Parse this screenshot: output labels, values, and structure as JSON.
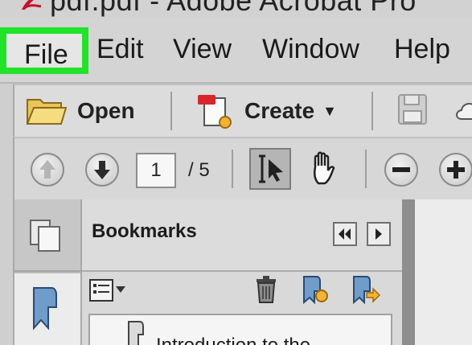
{
  "window": {
    "title": "pdf.pdf - Adobe Acrobat Pro"
  },
  "menu": {
    "items": [
      {
        "label": "File",
        "highlighted": true
      },
      {
        "label": "Edit"
      },
      {
        "label": "View"
      },
      {
        "label": "Window"
      },
      {
        "label": "Help"
      }
    ],
    "highlight_color": "#22e22a"
  },
  "toolbar": {
    "open_label": "Open",
    "create_label": "Create",
    "icons": [
      "folder-icon",
      "create-pdf-icon",
      "save-icon",
      "cloud-icon"
    ]
  },
  "navigation": {
    "current_page": "1",
    "total_pages": "/ 5",
    "icons": [
      "previous-page-icon",
      "next-page-icon",
      "select-tool-icon",
      "hand-tool-icon",
      "zoom-out-icon",
      "zoom-in-icon"
    ]
  },
  "bookmarks_panel": {
    "title": "Bookmarks",
    "items": [
      "Introduction to the"
    ],
    "icons": [
      "options-menu-icon",
      "delete-bookmark-icon",
      "new-bookmark-icon",
      "bookmark-from-structure-icon"
    ]
  },
  "colors": {
    "accent_green": "#22e22a",
    "bookmark_blue": "#6f9cc9"
  }
}
